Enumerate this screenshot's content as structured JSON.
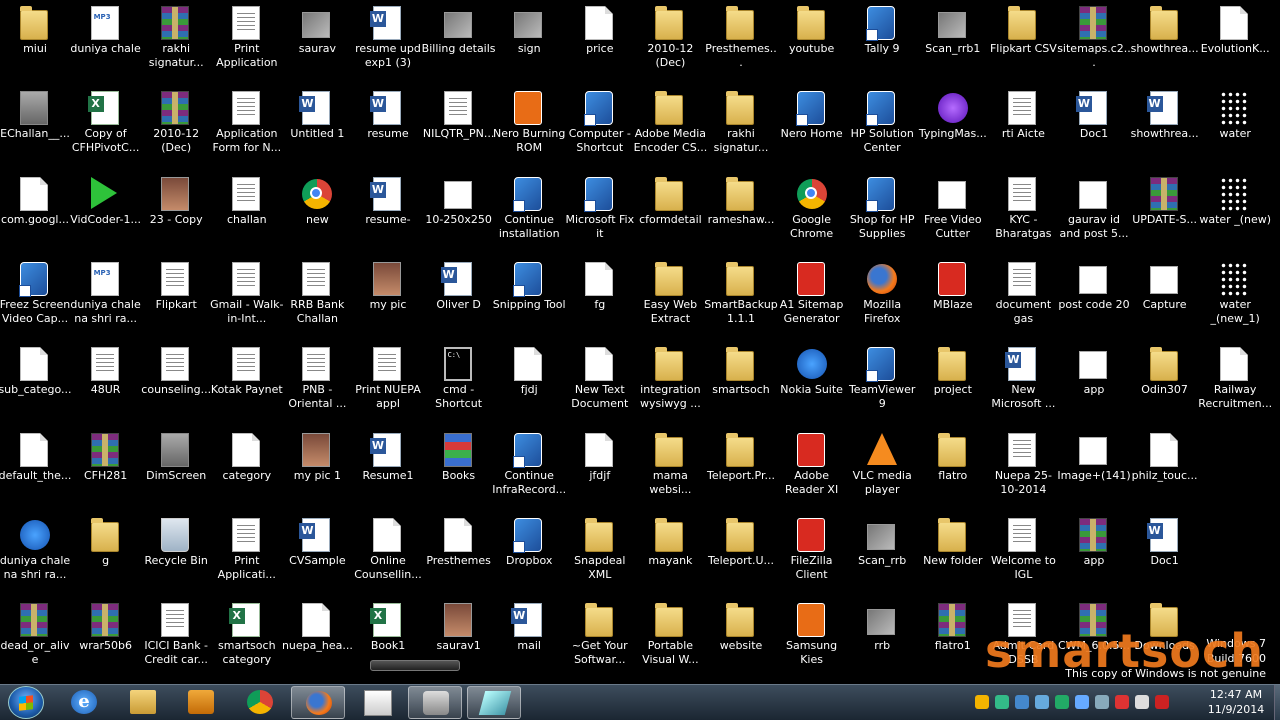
{
  "desktop": {
    "icons": [
      {
        "label": "miui",
        "kind": "folder"
      },
      {
        "label": "duniya chale",
        "kind": "mp3"
      },
      {
        "label": "rakhi signatur...",
        "kind": "rar"
      },
      {
        "label": "Print Application",
        "kind": "form"
      },
      {
        "label": "saurav",
        "kind": "img"
      },
      {
        "label": "resume upd exp1 (3)",
        "kind": "word"
      },
      {
        "label": "Billing details",
        "kind": "img"
      },
      {
        "label": "sign",
        "kind": "img"
      },
      {
        "label": "price",
        "kind": "doc"
      },
      {
        "label": "2010-12 (Dec)",
        "kind": "folder"
      },
      {
        "label": "Presthemes...",
        "kind": "folder"
      },
      {
        "label": "youtube",
        "kind": "folder"
      },
      {
        "label": "Tally 9",
        "kind": "shortcut"
      },
      {
        "label": "Scan_rrb1",
        "kind": "img"
      },
      {
        "label": "Flipkart CSV",
        "kind": "folder"
      },
      {
        "label": "sitemaps.c2...",
        "kind": "rar"
      },
      {
        "label": "showthrea...",
        "kind": "folder"
      },
      {
        "label": "EvolutionK...",
        "kind": "doc"
      },
      {
        "label": "EChallan__...",
        "kind": "gray"
      },
      {
        "label": "Copy of CFHPivotC...",
        "kind": "excel"
      },
      {
        "label": "2010-12 (Dec)",
        "kind": "rar"
      },
      {
        "label": "Application Form for N...",
        "kind": "form"
      },
      {
        "label": "Untitled 1",
        "kind": "word"
      },
      {
        "label": "resume",
        "kind": "word"
      },
      {
        "label": "NILQTR_PN...",
        "kind": "form"
      },
      {
        "label": "Nero Burning ROM",
        "kind": "orange"
      },
      {
        "label": "Computer - Shortcut",
        "kind": "shortcut"
      },
      {
        "label": "Adobe Media Encoder CS...",
        "kind": "folder"
      },
      {
        "label": "rakhi signatur...",
        "kind": "folder"
      },
      {
        "label": "Nero Home",
        "kind": "shortcut"
      },
      {
        "label": "HP Solution Center",
        "kind": "shortcut"
      },
      {
        "label": "TypingMas...",
        "kind": "purple"
      },
      {
        "label": "rti Aicte",
        "kind": "form"
      },
      {
        "label": "Doc1",
        "kind": "word"
      },
      {
        "label": "showthrea...",
        "kind": "word"
      },
      {
        "label": "water",
        "kind": "dots"
      },
      {
        "label": "com.googl...",
        "kind": "doc"
      },
      {
        "label": "VidCoder-1...",
        "kind": "green"
      },
      {
        "label": "23 - Copy",
        "kind": "photo"
      },
      {
        "label": "challan",
        "kind": "form"
      },
      {
        "label": "new",
        "kind": "chrome"
      },
      {
        "label": "resume-",
        "kind": "word"
      },
      {
        "label": "10-250x250",
        "kind": "white"
      },
      {
        "label": "Continue installation ...",
        "kind": "shortcut"
      },
      {
        "label": "Microsoft Fix it",
        "kind": "shortcut"
      },
      {
        "label": "cformdetail",
        "kind": "folder"
      },
      {
        "label": "rameshaw...",
        "kind": "folder"
      },
      {
        "label": "Google Chrome",
        "kind": "chrome"
      },
      {
        "label": "Shop for HP Supplies",
        "kind": "shortcut"
      },
      {
        "label": "Free Video Cutter",
        "kind": "white"
      },
      {
        "label": "KYC - Bharatgas",
        "kind": "form"
      },
      {
        "label": "gaurav id and post 5...",
        "kind": "white"
      },
      {
        "label": "UPDATE-S...",
        "kind": "rar"
      },
      {
        "label": "water _(new)",
        "kind": "dots"
      },
      {
        "label": "Freez Screen Video Cap...",
        "kind": "shortcut"
      },
      {
        "label": "duniya chale na shri ra...",
        "kind": "mp3"
      },
      {
        "label": "Flipkart",
        "kind": "form"
      },
      {
        "label": "Gmail - Walk-in-Int...",
        "kind": "form"
      },
      {
        "label": "RRB Bank Challan",
        "kind": "form"
      },
      {
        "label": "my pic",
        "kind": "photo"
      },
      {
        "label": "Oliver D",
        "kind": "word"
      },
      {
        "label": "Snipping Tool",
        "kind": "shortcut"
      },
      {
        "label": "fg",
        "kind": "doc"
      },
      {
        "label": "Easy Web Extract 2.7....",
        "kind": "folder"
      },
      {
        "label": "SmartBackup 1.1.1",
        "kind": "folder"
      },
      {
        "label": "A1 Sitemap Generator",
        "kind": "red"
      },
      {
        "label": "Mozilla Firefox",
        "kind": "firefox"
      },
      {
        "label": "MBlaze",
        "kind": "red"
      },
      {
        "label": "document gas",
        "kind": "form"
      },
      {
        "label": "post code 20",
        "kind": "white"
      },
      {
        "label": "Capture",
        "kind": "white"
      },
      {
        "label": "water _(new_1)",
        "kind": "dots"
      },
      {
        "label": "sub_catego...",
        "kind": "doc"
      },
      {
        "label": "48UR",
        "kind": "form"
      },
      {
        "label": "counseling...",
        "kind": "form"
      },
      {
        "label": "Kotak Paynet",
        "kind": "form"
      },
      {
        "label": "PNB -Oriental ...",
        "kind": "form"
      },
      {
        "label": "Print NUEPA appl",
        "kind": "form"
      },
      {
        "label": "cmd - Shortcut",
        "kind": "cmd"
      },
      {
        "label": "fjdj",
        "kind": "doc"
      },
      {
        "label": "New Text Document",
        "kind": "doc"
      },
      {
        "label": "integration wysiwyg ...",
        "kind": "folder"
      },
      {
        "label": "smartsoch",
        "kind": "folder"
      },
      {
        "label": "Nokia Suite",
        "kind": "blue"
      },
      {
        "label": "TeamViewer 9",
        "kind": "shortcut"
      },
      {
        "label": "project",
        "kind": "folder"
      },
      {
        "label": "New Microsoft ...",
        "kind": "word"
      },
      {
        "label": "app",
        "kind": "white"
      },
      {
        "label": "Odin307",
        "kind": "folder"
      },
      {
        "label": "Railway Recruitmen...",
        "kind": "doc"
      },
      {
        "label": "default_the...",
        "kind": "doc"
      },
      {
        "label": "CFH281",
        "kind": "rar"
      },
      {
        "label": "DimScreen",
        "kind": "gray"
      },
      {
        "label": "category",
        "kind": "doc"
      },
      {
        "label": "my pic 1",
        "kind": "photo"
      },
      {
        "label": "Resume1",
        "kind": "word"
      },
      {
        "label": "Books",
        "kind": "books"
      },
      {
        "label": "Continue InfraRecord...",
        "kind": "shortcut"
      },
      {
        "label": "jfdjf",
        "kind": "doc"
      },
      {
        "label": "mama websi...",
        "kind": "folder"
      },
      {
        "label": "Teleport.Pr...",
        "kind": "folder"
      },
      {
        "label": "Adobe Reader XI",
        "kind": "red"
      },
      {
        "label": "VLC media player",
        "kind": "vlc"
      },
      {
        "label": "flatro",
        "kind": "folder"
      },
      {
        "label": "Nuepa 25-10-2014",
        "kind": "form"
      },
      {
        "label": "Image+(141)",
        "kind": "white"
      },
      {
        "label": "philz_touc...",
        "kind": "doc"
      },
      {
        "label": "duniya chale na shri ra...",
        "kind": "blue"
      },
      {
        "label": "g",
        "kind": "folder"
      },
      {
        "label": "Recycle Bin",
        "kind": "recycle"
      },
      {
        "label": "Print Applicati...",
        "kind": "form"
      },
      {
        "label": "CVSample",
        "kind": "word"
      },
      {
        "label": "Online Counsellin...",
        "kind": "doc"
      },
      {
        "label": "Presthemes",
        "kind": "doc"
      },
      {
        "label": "Dropbox",
        "kind": "shortcut"
      },
      {
        "label": "Snapdeal XML",
        "kind": "folder"
      },
      {
        "label": "mayank",
        "kind": "folder"
      },
      {
        "label": "Teleport.U...",
        "kind": "folder"
      },
      {
        "label": "FileZilla Client",
        "kind": "red"
      },
      {
        "label": "Scan_rrb",
        "kind": "img"
      },
      {
        "label": "New folder",
        "kind": "folder"
      },
      {
        "label": "Welcome to IGL",
        "kind": "form"
      },
      {
        "label": "app",
        "kind": "rar"
      },
      {
        "label": "Doc1",
        "kind": "word"
      },
      {
        "label": "dead_or_alive",
        "kind": "rar"
      },
      {
        "label": "wrar50b6",
        "kind": "rar"
      },
      {
        "label": "ICICI Bank - Credit car...",
        "kind": "form"
      },
      {
        "label": "smartsoch category",
        "kind": "excel"
      },
      {
        "label": "nuepa_hea...",
        "kind": "doc"
      },
      {
        "label": "Book1",
        "kind": "excel"
      },
      {
        "label": "saurav1",
        "kind": "photo"
      },
      {
        "label": "mail",
        "kind": "word"
      },
      {
        "label": "~Get Your Softwar...",
        "kind": "folder"
      },
      {
        "label": "Portable Visual W...",
        "kind": "folder"
      },
      {
        "label": "website",
        "kind": "folder"
      },
      {
        "label": "Samsung Kies",
        "kind": "orange"
      },
      {
        "label": "rrb",
        "kind": "img"
      },
      {
        "label": "flatro1",
        "kind": "rar"
      },
      {
        "label": "Admit Card DSSB",
        "kind": "form"
      },
      {
        "label": "CWM_6.0.5...",
        "kind": "rar"
      },
      {
        "label": "Downloads",
        "kind": "folder"
      }
    ],
    "rows": [
      18,
      18,
      18,
      18,
      18,
      17,
      17,
      17
    ]
  },
  "watermark": {
    "line1": "Windows 7",
    "line2": "Build 7600",
    "line3": "This copy of Windows is not genuine"
  },
  "brand": "smartsoch",
  "taskbar": {
    "items": [
      {
        "name": "internet-explorer",
        "icon": "ie-icon",
        "active": false
      },
      {
        "name": "windows-explorer",
        "icon": "folder-icon",
        "active": false
      },
      {
        "name": "media-player",
        "icon": "media-player-icon",
        "active": false
      },
      {
        "name": "google-chrome",
        "icon": "chrome-icon",
        "active": false
      },
      {
        "name": "firefox",
        "icon": "firefox-icon",
        "active": true
      },
      {
        "name": "window",
        "icon": "window-icon",
        "active": false
      },
      {
        "name": "camera-app",
        "icon": "camera-icon",
        "active": true
      },
      {
        "name": "snipping-tool",
        "icon": "snipping-tool-icon",
        "active": true
      }
    ],
    "clock": {
      "time": "12:47 AM",
      "date": "11/9/2014"
    }
  }
}
